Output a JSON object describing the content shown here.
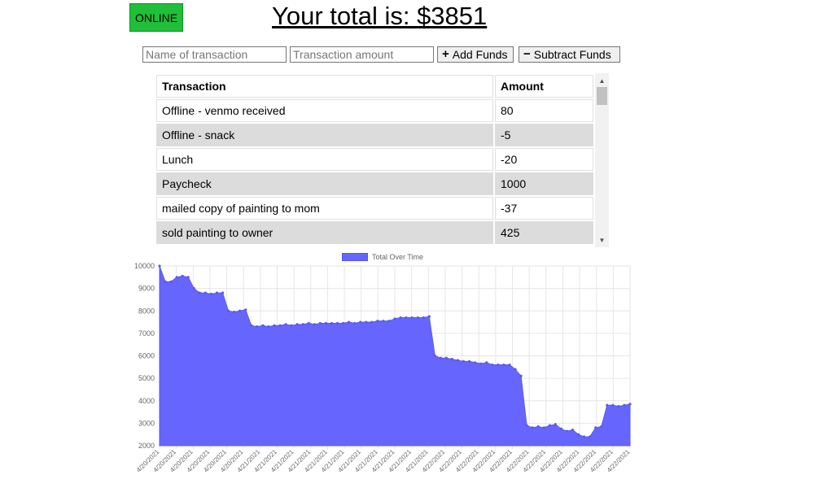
{
  "status": {
    "label": "ONLINE",
    "color": "#1fbf3a"
  },
  "header": {
    "title": "Your total is: $3851"
  },
  "form": {
    "name_placeholder": "Name of transaction",
    "amount_placeholder": "Transaction amount",
    "add_label": "Add Funds",
    "subtract_label": "Subtract Funds",
    "add_glyph": "+",
    "subtract_glyph": "−"
  },
  "table": {
    "headers": [
      "Transaction",
      "Amount"
    ],
    "rows": [
      {
        "name": "Offline - venmo received",
        "amount": "80"
      },
      {
        "name": "Offline - snack",
        "amount": "-5"
      },
      {
        "name": "Lunch",
        "amount": "-20"
      },
      {
        "name": "Paycheck",
        "amount": "1000"
      },
      {
        "name": "mailed copy of painting to mom",
        "amount": "-37"
      },
      {
        "name": "sold painting to owner",
        "amount": "425"
      }
    ]
  },
  "chart_data": {
    "type": "area",
    "series": [
      {
        "name": "Total Over Time",
        "color": "#6666ff",
        "values": [
          10000,
          9300,
          9300,
          9500,
          9550,
          9500,
          9000,
          8800,
          8800,
          8750,
          8800,
          8800,
          8000,
          7950,
          8000,
          8050,
          7350,
          7300,
          7350,
          7300,
          7350,
          7350,
          7400,
          7350,
          7400,
          7400,
          7450,
          7400,
          7450,
          7450,
          7450,
          7450,
          7450,
          7500,
          7450,
          7500,
          7500,
          7500,
          7550,
          7550,
          7550,
          7650,
          7700,
          7700,
          7700,
          7700,
          7700,
          7750,
          6000,
          5900,
          5900,
          5850,
          5800,
          5750,
          5750,
          5700,
          5650,
          5700,
          5600,
          5600,
          5600,
          5600,
          5400,
          5100,
          2900,
          2800,
          2850,
          2800,
          2900,
          2950,
          2750,
          2650,
          2700,
          2500,
          2400,
          2400,
          2800,
          2850,
          3800,
          3800,
          3750,
          3800,
          3851
        ]
      }
    ],
    "x_tick_labels": [
      "4/20/2021",
      "4/20/2021",
      "4/20/2021",
      "4/20/2021",
      "4/20/2021",
      "4/20/2021",
      "4/21/2021",
      "4/21/2021",
      "4/21/2021",
      "4/21/2021",
      "4/21/2021",
      "4/21/2021",
      "4/21/2021",
      "4/21/2021",
      "4/21/2021",
      "4/21/2021",
      "4/21/2021",
      "4/22/2021",
      "4/22/2021",
      "4/22/2021",
      "4/22/2021",
      "4/22/2021",
      "4/22/2021",
      "4/22/2021",
      "4/22/2021",
      "4/22/2021",
      "4/22/2021",
      "4/22/2021",
      "4/22/2021"
    ],
    "y_ticks": [
      10000,
      9000,
      8000,
      7000,
      6000,
      5000,
      4000,
      3000,
      2000
    ],
    "ylim": [
      2000,
      10000
    ],
    "grid": true,
    "legend": "top-center"
  }
}
